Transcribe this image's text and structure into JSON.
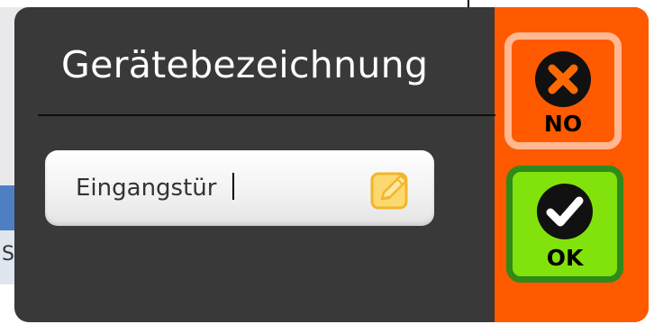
{
  "dialog": {
    "title": "Gerätebezeichnung",
    "input": {
      "value": "Eingangstür",
      "placeholder": ""
    },
    "edit_icon": "pencil-edit-icon",
    "buttons": {
      "no": {
        "label": "NO",
        "icon": "x-circle-icon"
      },
      "ok": {
        "label": "OK",
        "icon": "check-circle-icon"
      }
    }
  },
  "background": {
    "partial_letter": "S"
  },
  "colors": {
    "dialog_bg": "#393939",
    "accent_orange": "#ff5a00",
    "no_border": "#ffb892",
    "ok_bg": "#82e30c",
    "ok_border": "#2f8a1a",
    "edit_icon": "#f7c948"
  }
}
